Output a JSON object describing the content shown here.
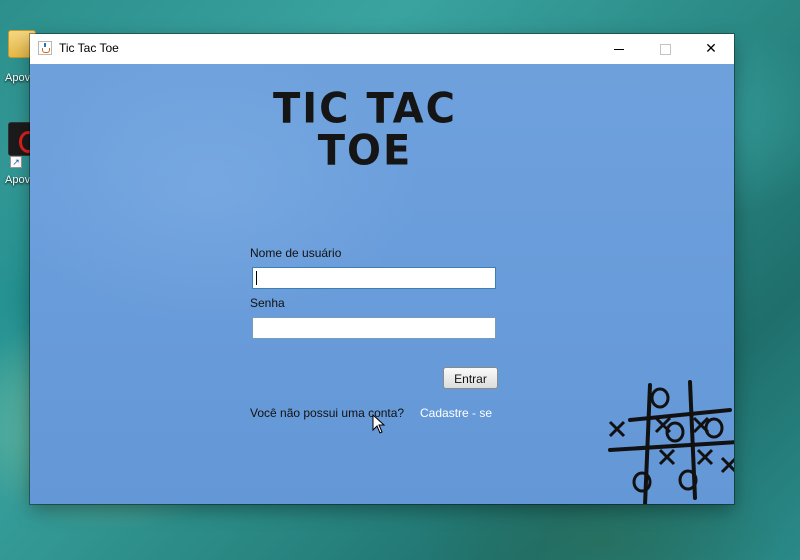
{
  "desktop": {
    "icons": [
      {
        "label": "Apov"
      },
      {
        "label": "Apov"
      }
    ]
  },
  "window": {
    "title": "Tic Tac Toe",
    "controls": {
      "minimize": "minimize",
      "maximize": "maximize",
      "close": "✕"
    }
  },
  "logo": {
    "line1": "TIC TAC",
    "line2": "TOE"
  },
  "form": {
    "username_label": "Nome de usuário",
    "username_value": "",
    "password_label": "Senha",
    "password_value": "",
    "submit_label": "Entrar"
  },
  "footer": {
    "no_account_text": "Você não possui uma conta?",
    "signup_link": "Cadastre - se"
  },
  "colors": {
    "content_bg": "#6a9ddb",
    "link": "#ffffff"
  }
}
